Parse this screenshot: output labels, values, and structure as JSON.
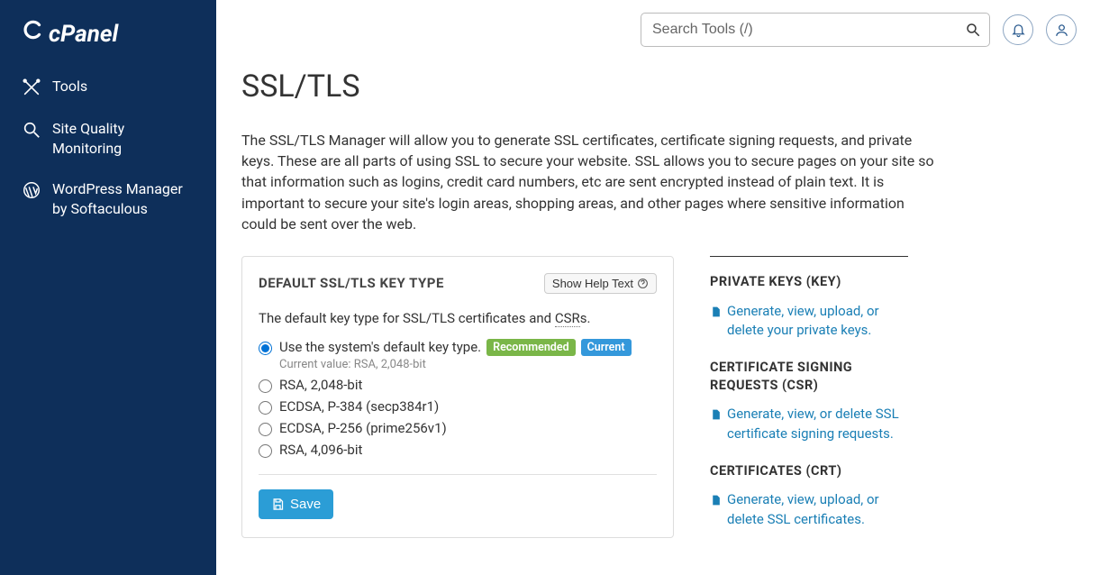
{
  "brand": "cPanel",
  "sidebar": {
    "items": [
      {
        "label": "Tools",
        "icon": "tools-icon"
      },
      {
        "label": "Site Quality Monitoring",
        "icon": "magnify-icon"
      },
      {
        "label": "WordPress Manager by Softaculous",
        "icon": "wordpress-icon"
      }
    ]
  },
  "search": {
    "placeholder": "Search Tools (/)"
  },
  "page": {
    "title": "SSL/TLS",
    "intro": "The SSL/TLS Manager will allow you to generate SSL certificates, certificate signing requests, and private keys. These are all parts of using SSL to secure your website. SSL allows you to secure pages on your site so that information such as logins, credit card numbers, etc are sent encrypted instead of plain text. It is important to secure your site's login areas, shopping areas, and other pages where sensitive information could be sent over the web."
  },
  "card": {
    "title": "DEFAULT SSL/TLS KEY TYPE",
    "help_btn": "Show Help Text",
    "desc_before": "The default key type for SSL/TLS certificates and ",
    "desc_csr": "CSR",
    "desc_after": "s.",
    "options": [
      {
        "label": "Use the system's default key type.",
        "checked": true,
        "recommended": true,
        "current": true,
        "current_value": "Current value: RSA, 2,048-bit"
      },
      {
        "label": "RSA, 2,048-bit"
      },
      {
        "label": "ECDSA, P-384 (secp384r1)"
      },
      {
        "label": "ECDSA, P-256 (prime256v1)"
      },
      {
        "label": "RSA, 4,096-bit"
      }
    ],
    "badge_recommended": "Recommended",
    "badge_current": "Current",
    "save_label": "Save"
  },
  "side": {
    "sections": [
      {
        "title": "PRIVATE KEYS (KEY)",
        "link": "Generate, view, upload, or delete your private keys."
      },
      {
        "title": "CERTIFICATE SIGNING REQUESTS (CSR)",
        "link": "Generate, view, or delete SSL certificate signing requests."
      },
      {
        "title": "CERTIFICATES (CRT)",
        "link": "Generate, view, upload, or delete SSL certificates."
      }
    ]
  }
}
